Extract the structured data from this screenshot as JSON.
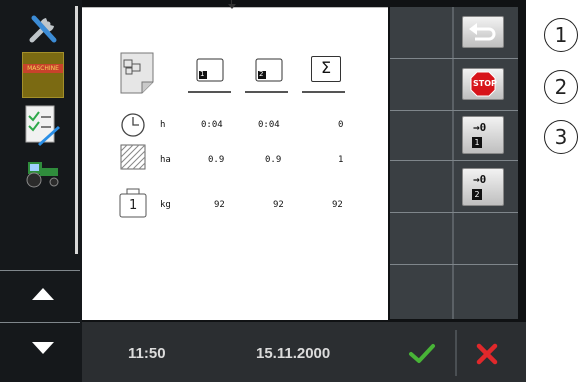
{
  "table": {
    "rows": [
      {
        "unit": "h",
        "values": [
          "0:04",
          "0:04",
          "0"
        ]
      },
      {
        "unit": "ha",
        "values": [
          "0.9",
          "0.9",
          "1"
        ]
      },
      {
        "unit": "kg",
        "values": [
          "92",
          "92",
          "92"
        ]
      }
    ],
    "column_icons": [
      "counter-1-icon",
      "counter-2-icon",
      "sum-icon"
    ],
    "sum_symbol": "Σ",
    "counter_1_label": "1",
    "counter_2_label": "2",
    "weight_icon_label": "1"
  },
  "softkeys": {
    "back": "back-arrow-icon",
    "stop": "STOP",
    "reset_1_label": "→0",
    "reset_1_badge": "1",
    "reset_2_label": "→0",
    "reset_2_badge": "2"
  },
  "callouts": [
    "1",
    "2",
    "3"
  ],
  "status": {
    "time": "11:50",
    "date": "15.11.2000"
  },
  "left_nav": {
    "icons": [
      "tools-icon",
      "machine-card-icon",
      "checklist-icon",
      "tractor-icon"
    ],
    "card_text": "MASCHINE"
  },
  "colors": {
    "confirm": "#48b437",
    "cancel": "#e0282b",
    "stop": "#d7141a"
  }
}
